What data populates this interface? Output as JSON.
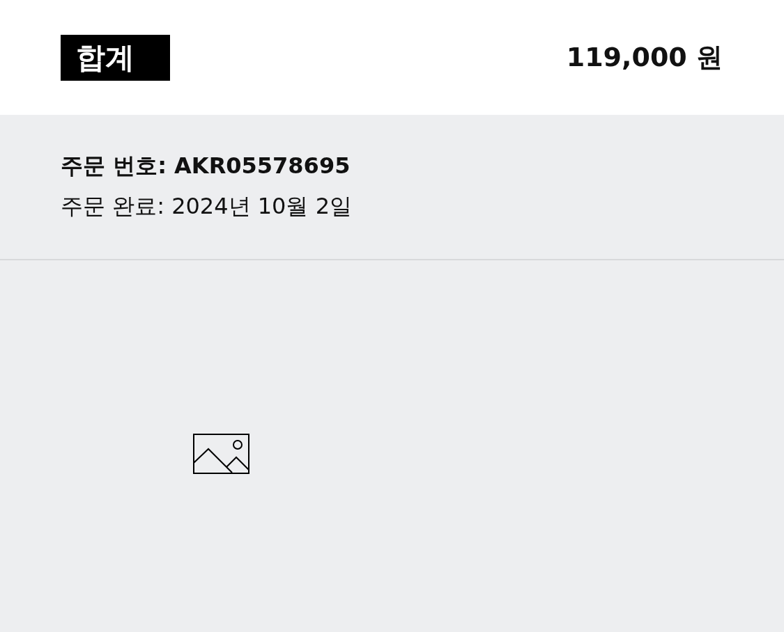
{
  "total": {
    "label": "합계",
    "amount": "119,000 원"
  },
  "order": {
    "number": "주문 번호: AKR05578695",
    "completed": "주문 완료: 2024년 10월 2일"
  }
}
